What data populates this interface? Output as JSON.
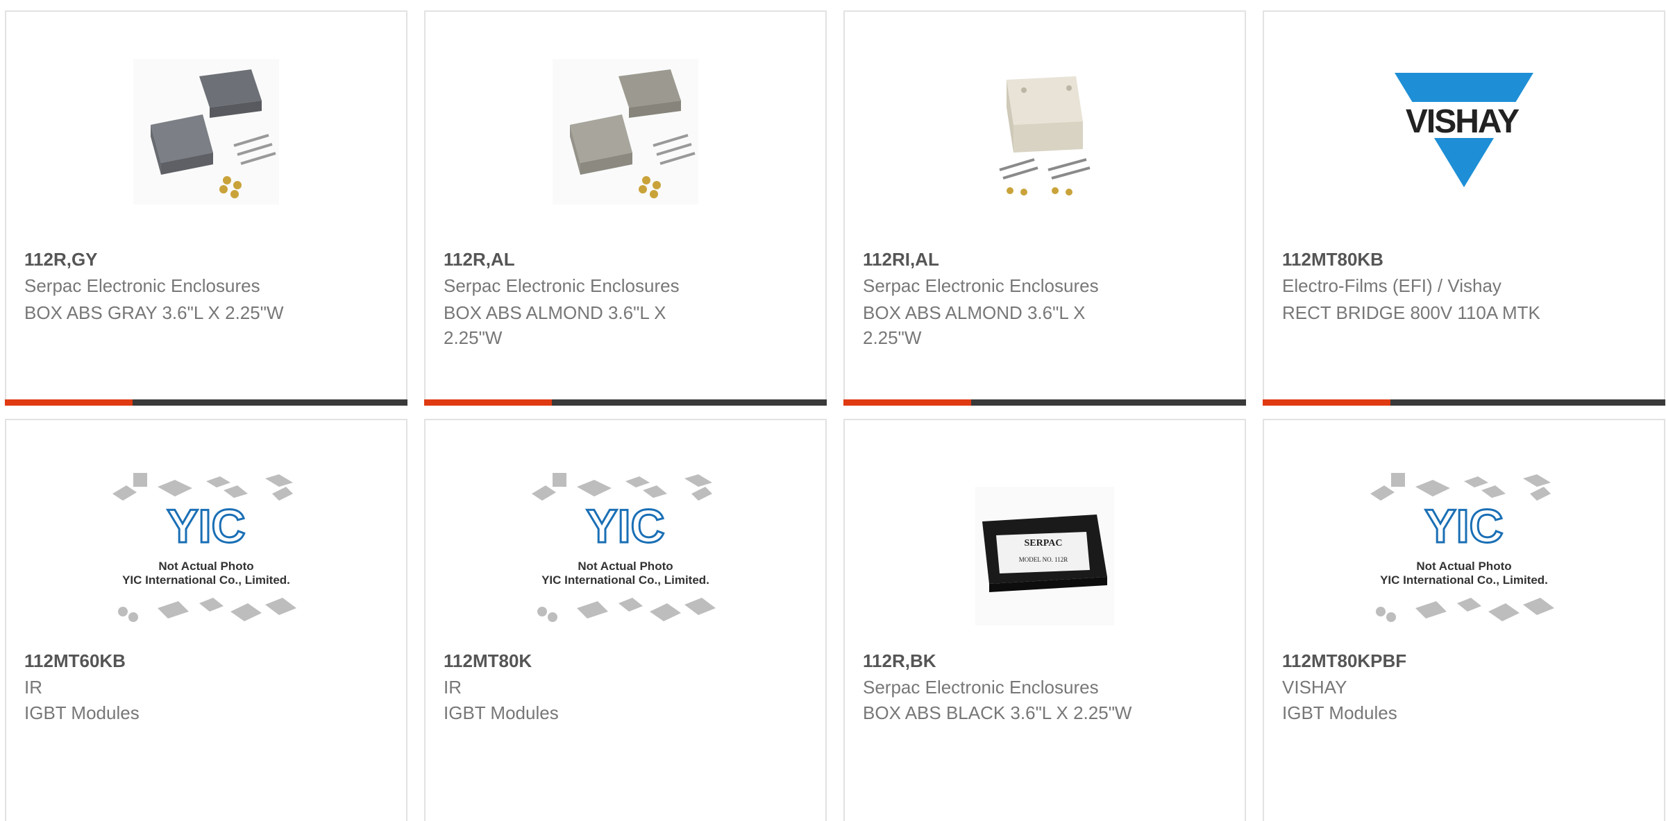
{
  "products": [
    {
      "part": "112R,GY",
      "brand": "Serpac Electronic Enclosures",
      "desc": "BOX ABS GRAY 3.6\"L X 2.25\"W",
      "image": "gray-enclosure"
    },
    {
      "part": "112R,AL",
      "brand": "Serpac Electronic Enclosures",
      "desc": "BOX ABS ALMOND 3.6\"L X 2.25\"W",
      "image": "almond-enclosure"
    },
    {
      "part": "112RI,AL",
      "brand": "Serpac Electronic Enclosures",
      "desc": "BOX ABS ALMOND 3.6\"L X 2.25\"W",
      "image": "almond-enclosure-white"
    },
    {
      "part": "112MT80KB",
      "brand": "Electro-Films (EFI) / Vishay",
      "desc": "RECT BRIDGE 800V 110A MTK",
      "image": "vishay-logo",
      "logo_text": "VISHAY"
    },
    {
      "part": "112MT60KB",
      "brand": "IR",
      "desc": "IGBT Modules",
      "image": "not-actual-photo",
      "placeholder_line1": "Not Actual Photo",
      "placeholder_line2": "YIC International Co., Limited.",
      "placeholder_logo": "YIC"
    },
    {
      "part": "112MT80K",
      "brand": "IR",
      "desc": "IGBT Modules",
      "image": "not-actual-photo",
      "placeholder_line1": "Not Actual Photo",
      "placeholder_line2": "YIC International Co., Limited.",
      "placeholder_logo": "YIC"
    },
    {
      "part": "112R,BK",
      "brand": "Serpac Electronic Enclosures",
      "desc": "BOX ABS BLACK 3.6\"L X 2.25\"W",
      "image": "black-enclosure",
      "label_line1": "SERPAC",
      "label_line2": "MODEL NO. 112R"
    },
    {
      "part": "112MT80KPBF",
      "brand": "VISHAY",
      "desc": "IGBT Modules",
      "image": "not-actual-photo",
      "placeholder_line1": "Not Actual Photo",
      "placeholder_line2": "YIC International Co., Limited.",
      "placeholder_logo": "YIC"
    }
  ],
  "colors": {
    "accent": "#e03a12",
    "bar": "#3a3a3a",
    "vishay_blue": "#1e8fd6",
    "yic_blue": "#1a6fb5"
  }
}
